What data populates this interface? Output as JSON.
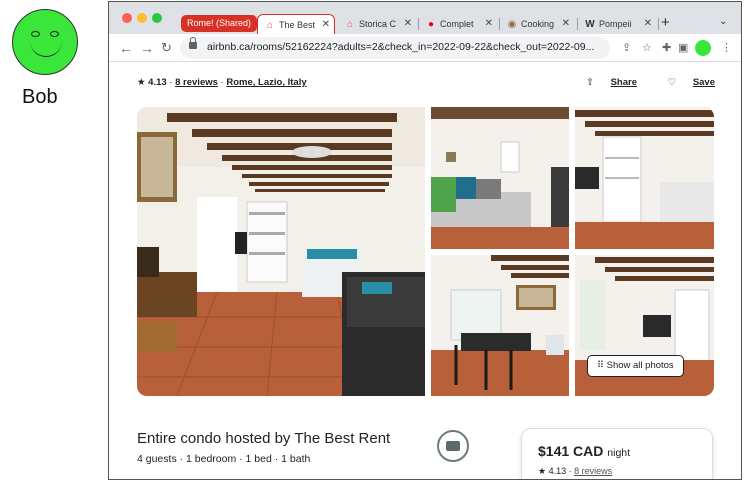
{
  "user": {
    "name": "Bob",
    "avatar_color": "#39e639"
  },
  "browser": {
    "tab_group_label": "Rome! (Shared)",
    "tab_group_color": "#d93025",
    "tabs": [
      {
        "label": "The Best",
        "icon": "airbnb-icon",
        "active": true
      },
      {
        "label": "Storica C",
        "icon": "airbnb-icon",
        "active": false
      },
      {
        "label": "Complet",
        "icon": "pinterest-icon",
        "active": false
      },
      {
        "label": "Cooking",
        "icon": "cooking-icon",
        "active": false
      },
      {
        "label": "Pompeii",
        "icon": "wikipedia-icon",
        "active": false
      }
    ],
    "url": "airbnb.ca/rooms/52162224?adults=2&check_in=2022-09-22&check_out=2022-09...",
    "profile_color": "#39e639"
  },
  "listing": {
    "rating": "4.13",
    "reviews": "8 reviews",
    "location": "Rome, Lazio, Italy",
    "share_label": "Share",
    "save_label": "Save",
    "show_all_label": "Show all photos",
    "title": "Entire condo hosted by The Best Rent",
    "details": "4 guests · 1 bedroom · 1 bed · 1 bath",
    "price": "$141 CAD",
    "price_unit": "night",
    "card_rating": "4.13",
    "card_reviews": "8 reviews"
  }
}
